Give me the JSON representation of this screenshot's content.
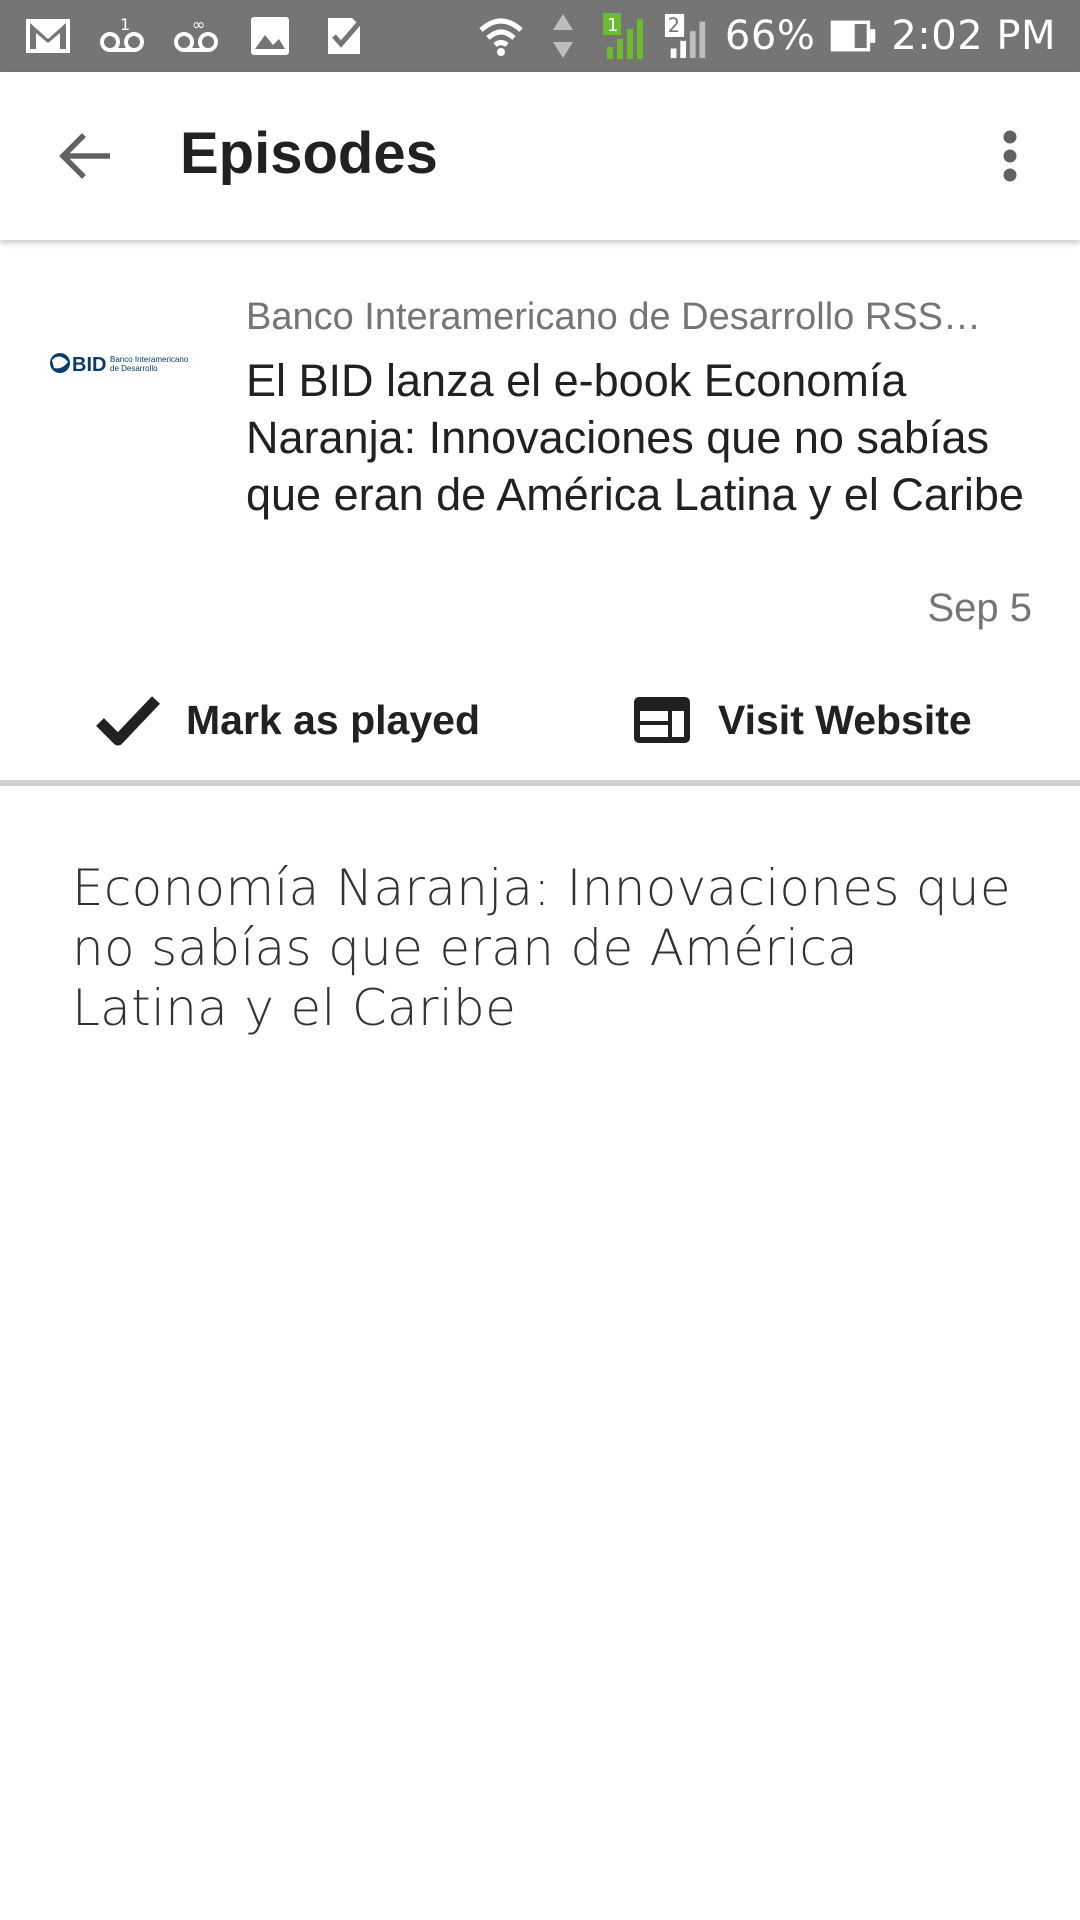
{
  "status_bar": {
    "left_icons": [
      "gmail-icon",
      "voicemail-icon",
      "voicemail-icon",
      "image-icon",
      "checkbox-icon"
    ],
    "sim_label": "2",
    "battery_percent": "66%",
    "time": "2:02 PM"
  },
  "app_bar": {
    "title": "Episodes",
    "back_icon": "arrow-back-icon",
    "menu_icon": "more-vert-icon"
  },
  "episode": {
    "art_logo_text": "BID",
    "art_logo_subtext": "Banco Interamericano de Desarrollo",
    "podcast_name": "Banco Interamericano de Desarrollo RSS…",
    "title": "El BID lanza el e-book Economía Naranja: Innovaciones que no sabías que eran de América Latina y el Caribe",
    "date": "Sep 5"
  },
  "actions": {
    "mark_played": "Mark as played",
    "visit_website": "Visit Website"
  },
  "description": "Economía Naranja: Innovaciones que no sabías que eran de América Latina y el Caribe",
  "colors": {
    "status_bar": "#757575",
    "signal_green": "#6dbb2f",
    "text_primary": "#212121",
    "text_secondary": "#757575",
    "logo_blue": "#0b3c6b"
  }
}
